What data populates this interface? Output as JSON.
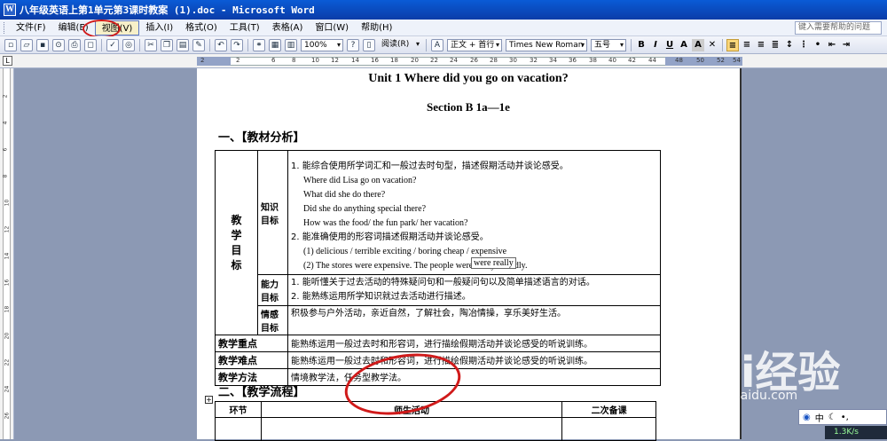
{
  "window": {
    "title": "八年级英语上第1单元第3课时教案 (1).doc - Microsoft Word",
    "icon": "word-icon"
  },
  "menu": {
    "items": [
      "文件(F)",
      "编辑(E)",
      "视图(V)",
      "插入(I)",
      "格式(O)",
      "工具(T)",
      "表格(A)",
      "窗口(W)",
      "帮助(H)"
    ],
    "highlighted": 2,
    "help_placeholder": "键入需要帮助的问题"
  },
  "toolbar": {
    "zoom": "100%",
    "read_label": "阅读(R)",
    "style": "正文 + 首行",
    "font": "Times New Roman",
    "size": "五号",
    "bold": "B",
    "italic": "I",
    "underline": "U"
  },
  "ruler": {
    "numbers": [
      "2",
      "2",
      "6",
      "8",
      "10",
      "12",
      "14",
      "16",
      "18",
      "20",
      "22",
      "24",
      "26",
      "28",
      "30",
      "32",
      "34",
      "36",
      "38",
      "40",
      "42",
      "44",
      "48",
      "50",
      "52",
      "54"
    ],
    "vnumbers": [
      "2",
      "4",
      "6",
      "8",
      "10",
      "12",
      "14",
      "16",
      "18",
      "20",
      "22",
      "24",
      "26"
    ]
  },
  "doc": {
    "title": "Unit 1 Where did you go on vacation?",
    "subtitle": "Section B 1a—1e",
    "section1": "一、【教材分析】",
    "objectives_label": [
      "教",
      "学",
      "目",
      "标"
    ],
    "knowledge_label": "知识目标",
    "knowledge": [
      "1.  能综合使用所学词汇和一般过去时句型，描述假期活动并谈论感受。",
      "Where did Lisa go on vacation?",
      "What did she do there?",
      "Did she do anything special there?",
      "How was the food/ the fun park/ her vacation?",
      "2.  能准确使用的形容词描述假期活动并谈论感受。",
      "(1) delicious / terrible        exciting / boring        cheap / expensive",
      "(2) The stores were expensive. The people were really friendly."
    ],
    "ability_label": "能力目标",
    "ability": [
      "1.  能听懂关于过去活动的特殊疑问句和一般疑问句以及简单描述语言的对话。",
      "2.  能熟练运用所学知识就过去活动进行描述。"
    ],
    "emotion_label": "情感目标",
    "emotion": "积极参与户外活动，亲近自然，了解社会，陶冶情操，享乐美好生活。",
    "key_label": "教学重点",
    "key": "能熟练运用一般过去时和形容词，进行描绘假期活动并谈论感受的听说训练。",
    "difficulty_label": "教学难点",
    "difficulty": "能熟练运用一般过去时和形容词，进行描绘假期活动并谈论感受的听说训练。",
    "method_label": "教学方法",
    "method": "情境教学法，任务型教学法。",
    "tooltip": "were really",
    "section2": "二、【教学流程】",
    "flow_headers": [
      "环节",
      "师生活动",
      "二次备课"
    ]
  },
  "overlay": {
    "site": "jingyan.baidu.com",
    "brand": "Bai经验"
  },
  "ime": {
    "mode": "中",
    "moon": "☾",
    "net": "1.3K/s"
  },
  "colors": {
    "title_bar": "#0a4bc4",
    "annotation": "#d01a1a",
    "app_bg": "#8c99b4"
  }
}
